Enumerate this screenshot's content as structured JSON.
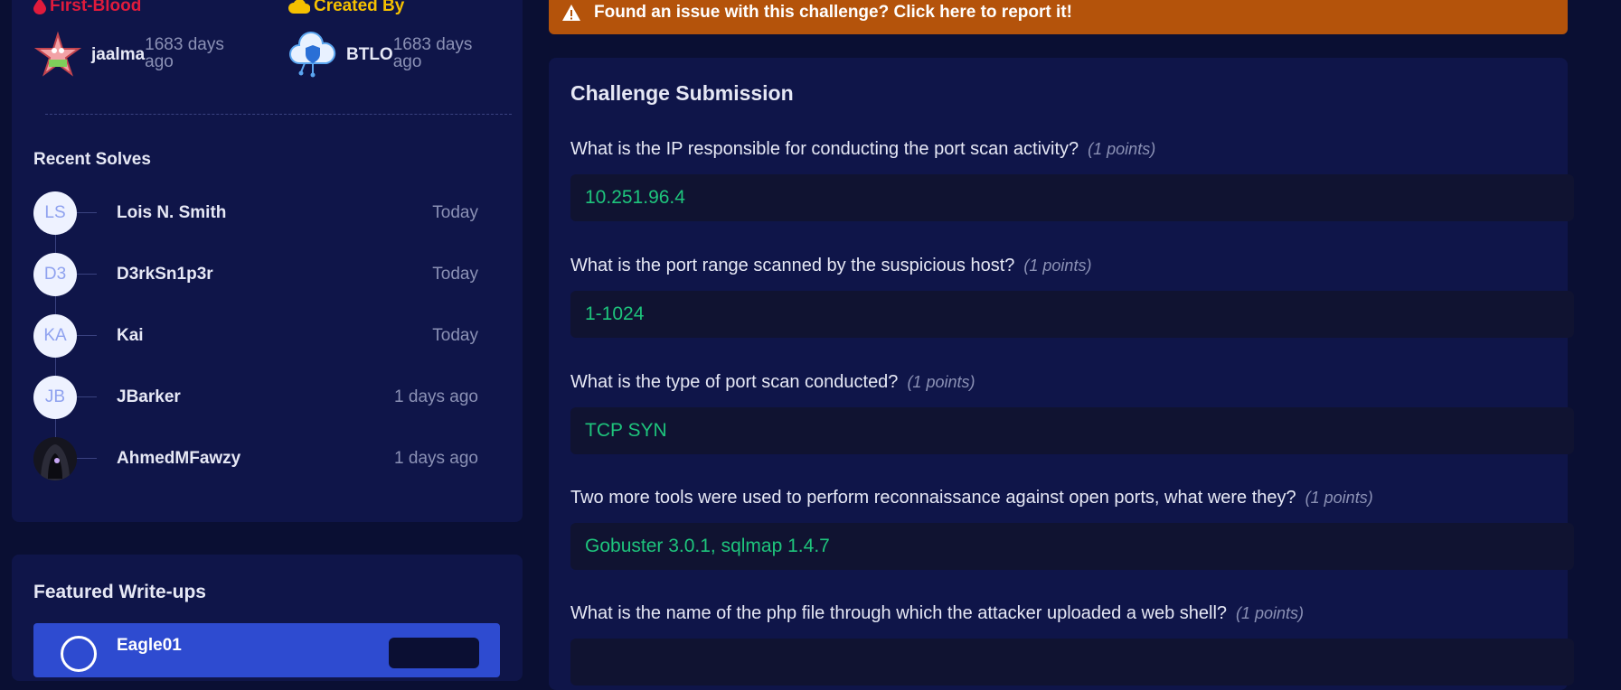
{
  "first_blood": {
    "title": "First-Blood",
    "user": "jaalma",
    "time": "1683 days ago",
    "color": "#e01b3c"
  },
  "created_by": {
    "title": "Created By",
    "user": "BTLO",
    "time": "1683 days ago",
    "color": "#f5c000"
  },
  "recent_solves": {
    "title": "Recent Solves",
    "items": [
      {
        "initials": "LS",
        "name": "Lois N. Smith",
        "time": "Today"
      },
      {
        "initials": "D3",
        "name": "D3rkSn1p3r",
        "time": "Today"
      },
      {
        "initials": "KA",
        "name": "Kai",
        "time": "Today"
      },
      {
        "initials": "JB",
        "name": "JBarker",
        "time": "1 days ago"
      },
      {
        "initials": "",
        "name": "AhmedMFawzy",
        "time": "1 days ago"
      }
    ]
  },
  "featured_writeups": {
    "title": "Featured Write-ups",
    "items": [
      {
        "name": "Eagle01"
      }
    ]
  },
  "report_banner": {
    "text": "Found an issue with this challenge? Click here to report it!",
    "color": "#b4530b"
  },
  "submission": {
    "title": "Challenge Submission",
    "questions": [
      {
        "text": "What is the IP responsible for conducting the port scan activity?",
        "points": "(1 points)",
        "answer": "10.251.96.4"
      },
      {
        "text": "What is the port range scanned by the suspicious host?",
        "points": "(1 points)",
        "answer": "1-1024"
      },
      {
        "text": "What is the type of port scan conducted?",
        "points": "(1 points)",
        "answer": "TCP SYN"
      },
      {
        "text": "Two more tools were used to perform reconnaissance against open ports, what were they?",
        "points": "(1 points)",
        "answer": "Gobuster 3.0.1, sqlmap 1.4.7"
      },
      {
        "text": "What is the name of the php file through which the attacker uploaded a web shell?",
        "points": "(1 points)",
        "answer": ""
      }
    ]
  },
  "icons": [
    "blood-drop-icon",
    "cloud-icon",
    "warning-triangle-icon"
  ]
}
